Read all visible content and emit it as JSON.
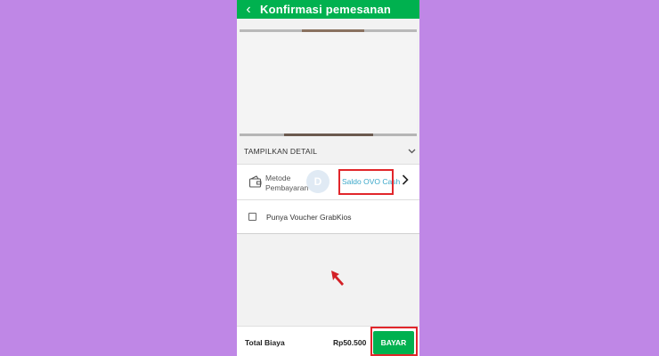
{
  "header": {
    "back_icon": "arrow-left-icon",
    "title": "Konfirmasi pemesanan"
  },
  "details": {
    "label": "TAMPILKAN DETAIL",
    "chevron_icon": "chevron-down-icon"
  },
  "payment": {
    "icon": "wallet-icon",
    "label": "Metode Pembayaran",
    "value": "Saldo OVO Cash",
    "chevron_icon": "chevron-right-icon"
  },
  "voucher": {
    "checked": false,
    "label": "Punya Voucher GrabKios"
  },
  "footer": {
    "total_label": "Total Biaya",
    "total_value": "Rp50.500",
    "pay_button": "BAYAR"
  },
  "colors": {
    "brand": "#00b14f",
    "highlight": "#e1262b",
    "link": "#3aa7c9",
    "background": "#bf87e6"
  }
}
